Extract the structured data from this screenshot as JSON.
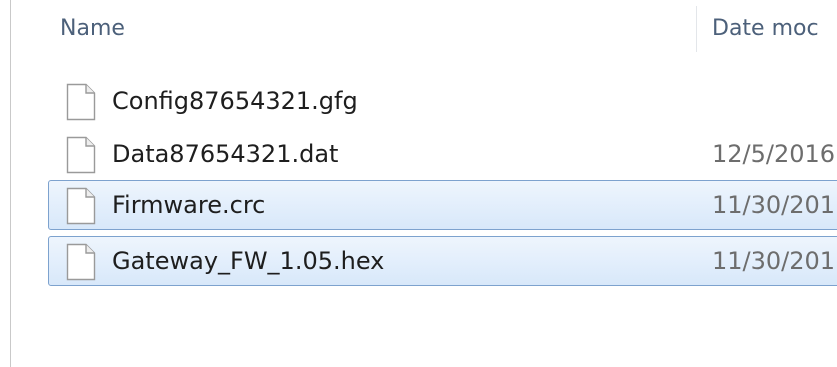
{
  "columns": {
    "name": "Name",
    "date_modified": "Date moc"
  },
  "files": [
    {
      "name": "Config87654321.gfg",
      "date": "",
      "selected": false,
      "icon": "document-icon"
    },
    {
      "name": "Data87654321.dat",
      "date": "12/5/2016",
      "selected": false,
      "icon": "document-icon"
    },
    {
      "name": "Firmware.crc",
      "date": "11/30/201",
      "selected": true,
      "icon": "document-icon"
    },
    {
      "name": "Gateway_FW_1.05.hex",
      "date": "11/30/201",
      "selected": true,
      "icon": "document-icon"
    }
  ],
  "colors": {
    "selection_fill": "#d8e8fa",
    "selection_border": "#7da2ce",
    "header_text": "#4c607a"
  }
}
